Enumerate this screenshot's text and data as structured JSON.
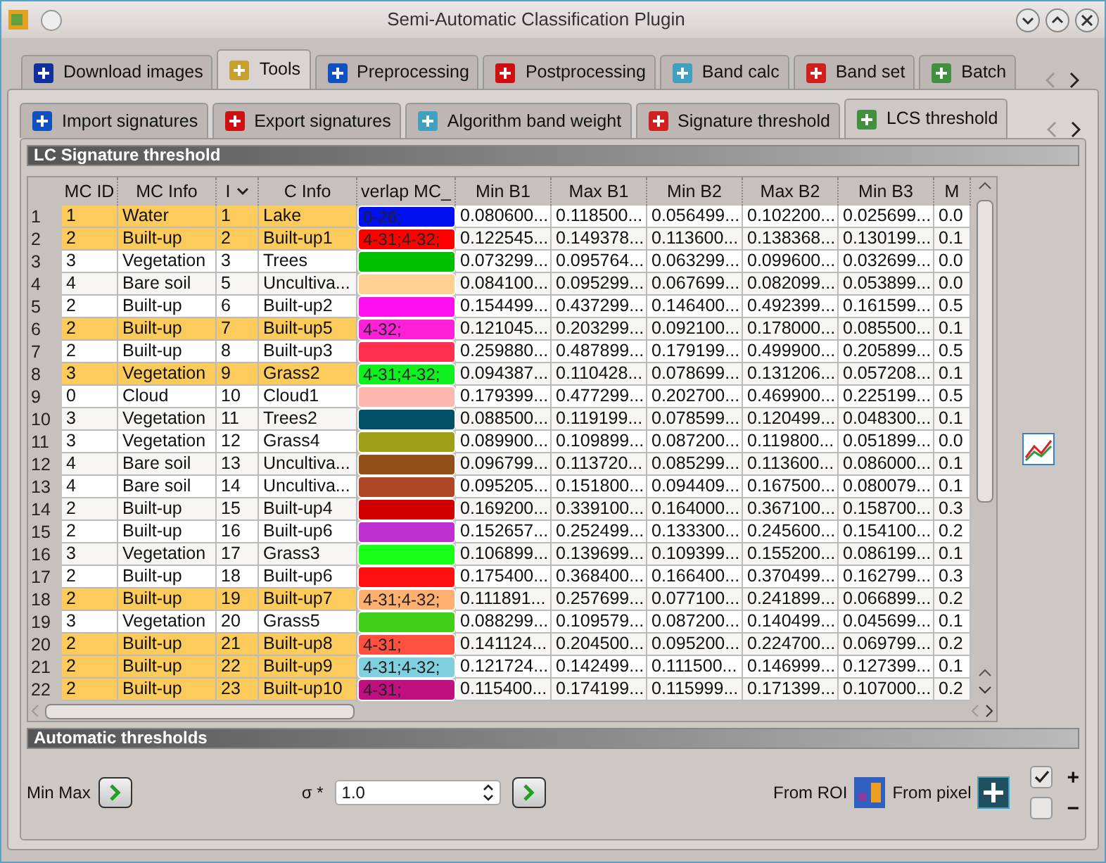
{
  "window": {
    "title": "Semi-Automatic Classification Plugin"
  },
  "main_tabs": [
    {
      "label": "Download images",
      "selected": false
    },
    {
      "label": "Tools",
      "selected": true
    },
    {
      "label": "Preprocessing",
      "selected": false
    },
    {
      "label": "Postprocessing",
      "selected": false
    },
    {
      "label": "Band calc",
      "selected": false
    },
    {
      "label": "Band set",
      "selected": false
    },
    {
      "label": "Batch",
      "selected": false
    }
  ],
  "sub_tabs": [
    {
      "label": "Import signatures",
      "selected": false
    },
    {
      "label": "Export signatures",
      "selected": false
    },
    {
      "label": "Algorithm band weight",
      "selected": false
    },
    {
      "label": "Signature threshold",
      "selected": false
    },
    {
      "label": "LCS threshold",
      "selected": true
    }
  ],
  "section_title": "LC Signature threshold",
  "table": {
    "columns": [
      "MC ID",
      "MC Info",
      "I",
      "C Info",
      "verlap MC_",
      "Min B1",
      "Max B1",
      "Min B2",
      "Max B2",
      "Min B3",
      "M"
    ],
    "rows": [
      {
        "n": "1",
        "highlighted": true,
        "color": "#0010f0",
        "cells": [
          "1",
          "Water",
          "1",
          "Lake",
          "0-26;",
          "0.080600...",
          "0.118500...",
          "0.056499...",
          "0.102200...",
          "0.025699...",
          "0.0"
        ]
      },
      {
        "n": "2",
        "highlighted": true,
        "color": "#ff0000",
        "cells": [
          "2",
          "Built-up",
          "2",
          "Built-up1",
          "4-31;4-32;",
          "0.122545...",
          "0.149378...",
          "0.113600...",
          "0.138368...",
          "0.130199...",
          "0.1"
        ]
      },
      {
        "n": "3",
        "highlighted": false,
        "color": "#00c000",
        "cells": [
          "3",
          "Vegetation",
          "3",
          "Trees",
          "",
          "0.073299...",
          "0.095764...",
          "0.063299...",
          "0.099600...",
          "0.032699...",
          "0.0"
        ]
      },
      {
        "n": "4",
        "highlighted": false,
        "color": "#ffd090",
        "cells": [
          "4",
          "Bare soil",
          "5",
          "Uncultiva...",
          "",
          "0.084100...",
          "0.095299...",
          "0.067699...",
          "0.082099...",
          "0.053899...",
          "0.0"
        ]
      },
      {
        "n": "5",
        "highlighted": false,
        "color": "#ff10f0",
        "cells": [
          "2",
          "Built-up",
          "6",
          "Built-up2",
          "",
          "0.154499...",
          "0.437299...",
          "0.146400...",
          "0.492399...",
          "0.161599...",
          "0.5"
        ]
      },
      {
        "n": "6",
        "highlighted": true,
        "color": "#ff20d8",
        "cells": [
          "2",
          "Built-up",
          "7",
          "Built-up5",
          "4-32;",
          "0.121045...",
          "0.203299...",
          "0.092100...",
          "0.178000...",
          "0.085500...",
          "0.1"
        ]
      },
      {
        "n": "7",
        "highlighted": false,
        "color": "#ff3050",
        "cells": [
          "2",
          "Built-up",
          "8",
          "Built-up3",
          "",
          "0.259880...",
          "0.487899...",
          "0.179199...",
          "0.499900...",
          "0.205899...",
          "0.5"
        ]
      },
      {
        "n": "8",
        "highlighted": true,
        "color": "#10f020",
        "cells": [
          "3",
          "Vegetation",
          "9",
          "Grass2",
          "4-31;4-32;",
          "0.094387...",
          "0.110428...",
          "0.078699...",
          "0.131206...",
          "0.057208...",
          "0.1"
        ]
      },
      {
        "n": "9",
        "highlighted": false,
        "color": "#ffb8b0",
        "cells": [
          "0",
          "Cloud",
          "10",
          "Cloud1",
          "",
          "0.179399...",
          "0.477299...",
          "0.202700...",
          "0.469900...",
          "0.225199...",
          "0.5"
        ]
      },
      {
        "n": "10",
        "highlighted": false,
        "color": "#005068",
        "cells": [
          "3",
          "Vegetation",
          "11",
          "Trees2",
          "",
          "0.088500...",
          "0.119199...",
          "0.078599...",
          "0.120499...",
          "0.048300...",
          "0.1"
        ]
      },
      {
        "n": "11",
        "highlighted": false,
        "color": "#a0a018",
        "cells": [
          "3",
          "Vegetation",
          "12",
          "Grass4",
          "",
          "0.089900...",
          "0.109899...",
          "0.087200...",
          "0.119800...",
          "0.051899...",
          "0.0"
        ]
      },
      {
        "n": "12",
        "highlighted": false,
        "color": "#905018",
        "cells": [
          "4",
          "Bare soil",
          "13",
          "Uncultiva...",
          "",
          "0.096799...",
          "0.113720...",
          "0.085299...",
          "0.113600...",
          "0.086000...",
          "0.1"
        ]
      },
      {
        "n": "13",
        "highlighted": false,
        "color": "#b04828",
        "cells": [
          "4",
          "Bare soil",
          "14",
          "Uncultiva...",
          "",
          "0.095205...",
          "0.151800...",
          "0.094409...",
          "0.167500...",
          "0.080079...",
          "0.1"
        ]
      },
      {
        "n": "14",
        "highlighted": false,
        "color": "#d00000",
        "cells": [
          "2",
          "Built-up",
          "15",
          "Built-up4",
          "",
          "0.169200...",
          "0.339100...",
          "0.164000...",
          "0.367100...",
          "0.158700...",
          "0.3"
        ]
      },
      {
        "n": "15",
        "highlighted": false,
        "color": "#c030d0",
        "cells": [
          "2",
          "Built-up",
          "16",
          "Built-up6",
          "",
          "0.152657...",
          "0.252499...",
          "0.133300...",
          "0.245600...",
          "0.154100...",
          "0.2"
        ]
      },
      {
        "n": "16",
        "highlighted": false,
        "color": "#18ff18",
        "cells": [
          "3",
          "Vegetation",
          "17",
          "Grass3",
          "",
          "0.106899...",
          "0.139699...",
          "0.109399...",
          "0.155200...",
          "0.086199...",
          "0.1"
        ]
      },
      {
        "n": "17",
        "highlighted": false,
        "color": "#ff1010",
        "cells": [
          "2",
          "Built-up",
          "18",
          "Built-up6",
          "",
          "0.175400...",
          "0.368400...",
          "0.166400...",
          "0.370499...",
          "0.162799...",
          "0.3"
        ]
      },
      {
        "n": "18",
        "highlighted": true,
        "color": "#ffb070",
        "cells": [
          "2",
          "Built-up",
          "19",
          "Built-up7",
          "4-31;4-32;",
          "0.111891...",
          "0.257699...",
          "0.077100...",
          "0.241899...",
          "0.066899...",
          "0.2"
        ]
      },
      {
        "n": "19",
        "highlighted": false,
        "color": "#40d018",
        "cells": [
          "3",
          "Vegetation",
          "20",
          "Grass5",
          "",
          "0.088299...",
          "0.109579...",
          "0.087200...",
          "0.140499...",
          "0.045699...",
          "0.1"
        ]
      },
      {
        "n": "20",
        "highlighted": true,
        "color": "#ff5040",
        "cells": [
          "2",
          "Built-up",
          "21",
          "Built-up8",
          "4-31;",
          "0.141124...",
          "0.204500...",
          "0.095200...",
          "0.224700...",
          "0.069799...",
          "0.2"
        ]
      },
      {
        "n": "21",
        "highlighted": true,
        "color": "#80d0e0",
        "cells": [
          "2",
          "Built-up",
          "22",
          "Built-up9",
          "4-31;4-32;",
          "0.121724...",
          "0.142499...",
          "0.111500...",
          "0.146999...",
          "0.127399...",
          "0.1"
        ]
      },
      {
        "n": "22",
        "highlighted": true,
        "color": "#c01080",
        "cells": [
          "2",
          "Built-up",
          "23",
          "Built-up10",
          "4-31;",
          "0.115400...",
          "0.174199...",
          "0.115999...",
          "0.171399...",
          "0.107000...",
          "0.2"
        ]
      }
    ]
  },
  "auto_title": "Automatic thresholds",
  "controls": {
    "min_max_label": "Min Max",
    "sigma_label": "σ *",
    "sigma_value": "1.0",
    "from_roi_label": "From ROI",
    "from_pixel_label": "From pixel",
    "add_checked": true,
    "remove_checked": false,
    "plus": "+",
    "minus": "−"
  }
}
